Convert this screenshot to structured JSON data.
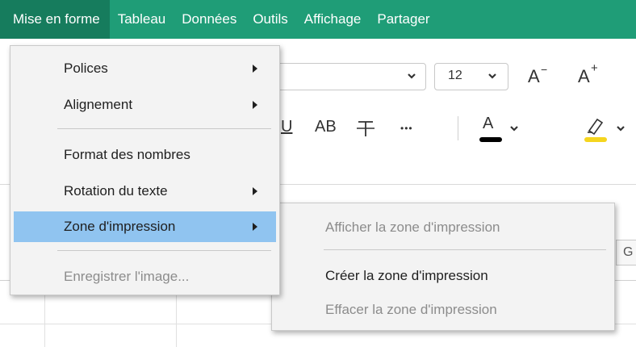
{
  "menubar": {
    "items": [
      "Mise en forme",
      "Tableau",
      "Données",
      "Outils",
      "Affichage",
      "Partager"
    ]
  },
  "toolbar": {
    "font_size": "12",
    "increase_font_label": "A",
    "decrease_font_label": "A",
    "increase_superscript": "+",
    "decrease_superscript": "−",
    "caps_label": "AB",
    "underline_fragment": "U",
    "more_label": "•••",
    "font_color_label": "A",
    "font_color": "#000000",
    "highlight_color": "#f5d51e",
    "partial_cell_text": "G"
  },
  "format_menu": {
    "items": [
      {
        "label": "Polices",
        "submenu": true,
        "disabled": false
      },
      {
        "label": "Alignement",
        "submenu": true,
        "disabled": false
      },
      {
        "label": "Format des nombres",
        "submenu": false,
        "disabled": false
      },
      {
        "label": "Rotation du texte",
        "submenu": true,
        "disabled": false
      },
      {
        "label": "Zone d'impression",
        "submenu": true,
        "disabled": false,
        "highlighted": true
      },
      {
        "label": "Enregistrer l'image...",
        "submenu": false,
        "disabled": true
      }
    ]
  },
  "print_area_submenu": {
    "items": [
      {
        "label": "Afficher la zone d'impression",
        "disabled": true
      },
      {
        "label": "Créer la zone d'impression",
        "disabled": false
      },
      {
        "label": "Effacer la zone d'impression",
        "disabled": true
      }
    ]
  },
  "colors": {
    "menubar_bg": "#1f9d77",
    "menubar_active": "#167c5d",
    "menu_highlight": "#90c4f0"
  }
}
